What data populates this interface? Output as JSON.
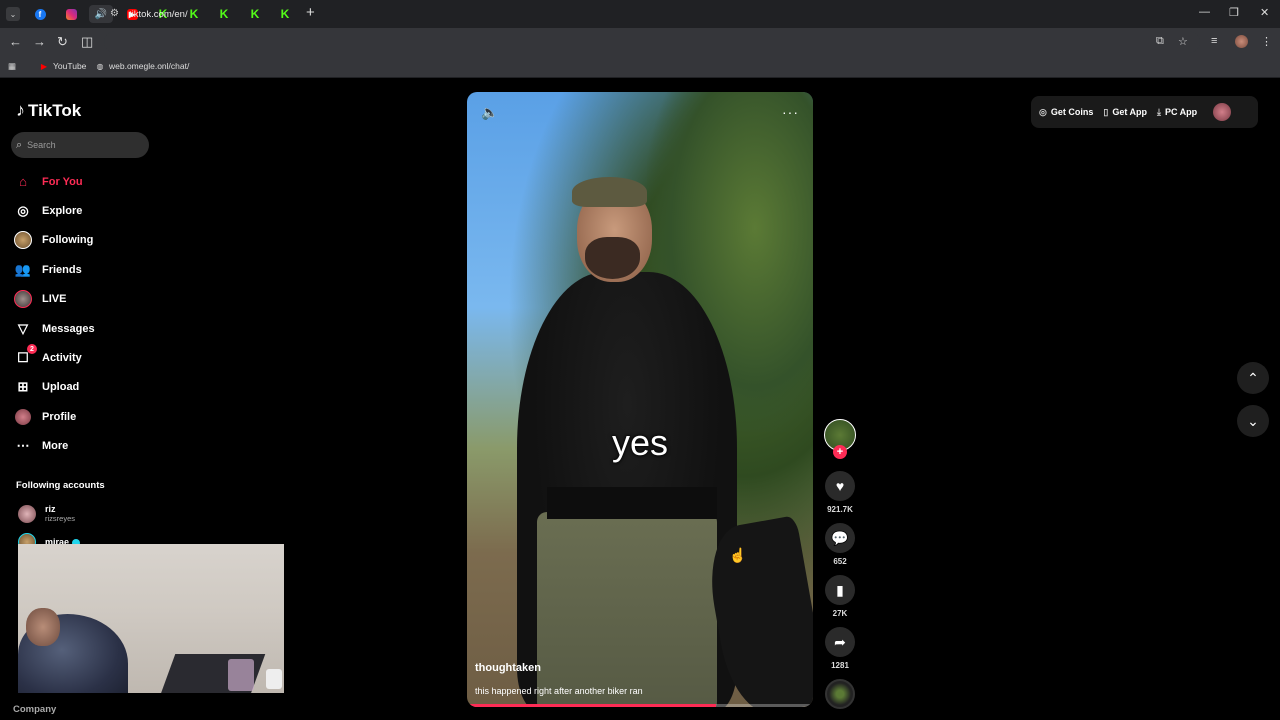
{
  "browser": {
    "tabs": [
      {
        "icon": "facebook-icon",
        "kind": "fb",
        "glyph": "f"
      },
      {
        "icon": "instagram-icon",
        "kind": "ig",
        "glyph": ""
      },
      {
        "icon": "speaker-icon",
        "kind": "speaker",
        "glyph": "🔊",
        "active": true
      },
      {
        "icon": "youtube-icon",
        "kind": "yt",
        "glyph": "▶"
      },
      {
        "icon": "kick-icon",
        "kind": "k",
        "glyph": "K"
      },
      {
        "icon": "kick-icon",
        "kind": "k",
        "glyph": "K"
      },
      {
        "icon": "kick-icon",
        "kind": "k",
        "glyph": "K"
      },
      {
        "icon": "kick-icon",
        "kind": "k",
        "glyph": "K"
      },
      {
        "icon": "kick-icon",
        "kind": "k",
        "glyph": "K"
      }
    ],
    "url": "tiktok.com/en/",
    "bookmarks": [
      {
        "label": "YouTube",
        "icon": "youtube-icon"
      },
      {
        "label": "web.omegle.onl/chat/",
        "icon": "globe-icon"
      }
    ]
  },
  "tiktok": {
    "logo_text": "TikTok",
    "search_placeholder": "Search",
    "nav": [
      {
        "label": "For You",
        "icon": "home-icon",
        "active": true
      },
      {
        "label": "Explore",
        "icon": "compass-icon"
      },
      {
        "label": "Following",
        "icon": "following-avatar-icon"
      },
      {
        "label": "Friends",
        "icon": "friends-icon"
      },
      {
        "label": "LIVE",
        "icon": "live-icon"
      },
      {
        "label": "Messages",
        "icon": "messages-icon"
      },
      {
        "label": "Activity",
        "icon": "activity-icon",
        "badge": "2"
      },
      {
        "label": "Upload",
        "icon": "upload-icon"
      },
      {
        "label": "Profile",
        "icon": "profile-icon"
      },
      {
        "label": "More",
        "icon": "more-icon"
      }
    ],
    "following_title": "Following accounts",
    "accounts": [
      {
        "name": "riz",
        "handle": "rizsreyes"
      },
      {
        "name": "mirae",
        "handle": ""
      }
    ],
    "footer_company": "Company",
    "topright": {
      "get_coins": "Get Coins",
      "get_app": "Get App",
      "pc_app": "PC App"
    },
    "video": {
      "overlay_text": "yes",
      "author": "thoughtaken",
      "description": "this happened right after another biker ran",
      "progress": 0.72
    },
    "actions": {
      "likes": "921.7K",
      "comments": "652",
      "saves": "27K",
      "shares": "1281"
    }
  },
  "colors": {
    "accent": "#fe2c55",
    "kick": "#53fc18"
  }
}
